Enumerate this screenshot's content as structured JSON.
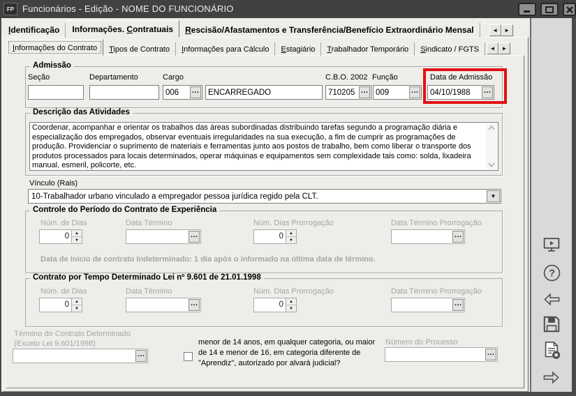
{
  "window": {
    "badge": "FP",
    "title": "Funcionários - Edição - NOME DO FUNCIONÁRIO",
    "controls": [
      "minimize-icon",
      "maximize-icon",
      "close-icon"
    ]
  },
  "icons": {
    "arrow_left": "◄",
    "arrow_right": "►",
    "combo_arrow": "▼",
    "browse": "…",
    "spin_up": "▲",
    "spin_down": "▼"
  },
  "tabs_row1": [
    {
      "label": "Identificação",
      "u": 0,
      "active": false
    },
    {
      "label": "Informações. Contratuais",
      "u": 13,
      "active": true
    },
    {
      "label": "Rescisão/Afastamentos e Transferência/Benefício Extraordinário Mensal",
      "u": 0,
      "active": false
    }
  ],
  "tabs_row2": [
    {
      "label": "Informações do Contrato",
      "u": 0,
      "active": true
    },
    {
      "label": "Tipos de Contrato",
      "u": 0,
      "active": false
    },
    {
      "label": "Informações para Cálculo",
      "u": 0,
      "active": false
    },
    {
      "label": "Estagiário",
      "u": 0,
      "active": false
    },
    {
      "label": "Trabalhador Temporário",
      "u": 0,
      "active": false
    },
    {
      "label": "Sindicato / FGTS",
      "u": 0,
      "active": false
    }
  ],
  "admissao": {
    "title": "Admissão",
    "secao": {
      "label": "Seção",
      "value": ""
    },
    "departamento": {
      "label": "Departamento",
      "value": ""
    },
    "cargo": {
      "label": "Cargo",
      "code": "006",
      "name": "ENCARREGADO"
    },
    "cbo": {
      "label": "C.B.O. 2002",
      "value": "710205"
    },
    "funcao": {
      "label": "Função",
      "value": "009"
    },
    "data_admissao": {
      "label": "Data de Admissão",
      "value": "04/10/1988"
    }
  },
  "descricao": {
    "title": "Descrição das Atividades",
    "text": "Coordenar, acompanhar e orientar os trabalhos das áreas subordinadas distribuindo tarefas segundo a programação diária e especialização dos empregados, observar eventuais irregularidades na sua execução, a fim de cumprir as programações de produção. Providenciar o suprimento de materiais e ferramentas junto aos postos de trabalho, bem como liberar o transporte dos produtos processados para locais determinados, operar máquinas e equipamentos sem complexidade tais como: solda, lixadeira manual, esmeril, policorte, etc."
  },
  "vinculo": {
    "label": "Vínculo (Rais)",
    "value": "10-Trabalhador urbano vinculado a empregador pessoa jurídica regido pela CLT."
  },
  "experiencia": {
    "title": "Controle do Período do Contrato de Experiência",
    "num_dias": {
      "label": "Núm. de Dias",
      "value": "0"
    },
    "data_termino": {
      "label": "Data Término",
      "value": ""
    },
    "num_dias_prorrogacao": {
      "label": "Núm. Dias Prorrogação",
      "value": "0"
    },
    "data_termino_prorrogacao": {
      "label": "Data Término Prorrogação",
      "value": ""
    },
    "note": "Data de inicio de contrato Indeterminado: 1 dia após o informado na última data de término."
  },
  "lei9601": {
    "title": "Contrato por Tempo Determinado Lei nº 9.601 de 21.01.1998",
    "num_dias": {
      "label": "Núm. de Dias",
      "value": "0"
    },
    "data_termino": {
      "label": "Data Término",
      "value": ""
    },
    "num_dias_prorrogacao": {
      "label": "Núm. Dias Prorrogação",
      "value": "0"
    },
    "data_termino_prorrogacao": {
      "label": "Data Término Prorrogação",
      "value": ""
    }
  },
  "rodape": {
    "termino_label1": "Término do Contrato Determinado",
    "termino_label2": "(Exceto Lei 9.601/1998)",
    "termino_value": "",
    "checkbox_checked": false,
    "checkbox_text": "menor de 14 anos, em qualquer categoria, ou maior de 14 e menor de 16, em categoria diferente de \"Aprendiz\", autorizado por alvará judicial?",
    "numero_processo": {
      "label": "Número do Processo",
      "value": ""
    }
  },
  "toolbar": {
    "icons": [
      "monitor-play-icon",
      "help-icon",
      "previous-record-icon",
      "save-icon",
      "delete-record-icon",
      "next-record-icon"
    ]
  },
  "colors": {
    "highlight_red": "#e21212",
    "titlebar": "#414141",
    "panel_bg": "#eeedea"
  }
}
